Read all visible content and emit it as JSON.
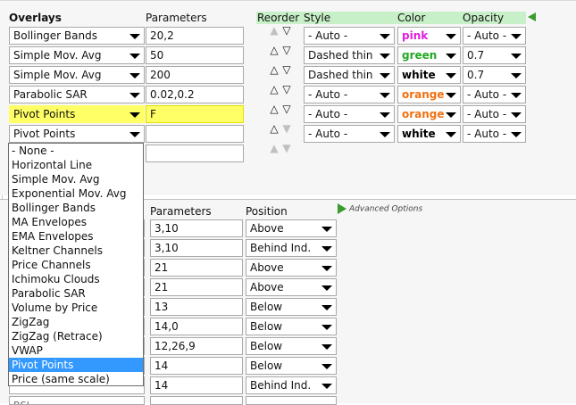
{
  "overlays_header": "Overlays",
  "parameters_header": "Parameters",
  "reorder_header": "Reorder",
  "style_header": "Style",
  "color_header": "Color",
  "opacity_header": "Opacity",
  "overlay_rows": [
    {
      "overlay": "Bollinger Bands",
      "params": "20,2",
      "style": "- Auto -",
      "color": "pink",
      "color_hex": "#e01ee0",
      "opacity": "- Auto -"
    },
    {
      "overlay": "Simple Mov. Avg",
      "params": "50",
      "style": "Dashed thin",
      "color": "green",
      "color_hex": "#22a822",
      "opacity": "0.7"
    },
    {
      "overlay": "Simple Mov. Avg",
      "params": "200",
      "style": "Dashed thin",
      "color": "white",
      "color_hex": "#000000",
      "opacity": "0.7"
    },
    {
      "overlay": "Parabolic SAR",
      "params": "0.02,0.2",
      "style": "- Auto -",
      "color": "orange",
      "color_hex": "#f07010",
      "opacity": "- Auto -"
    },
    {
      "overlay": "Pivot Points",
      "params": "F",
      "style": "- Auto -",
      "color": "orange",
      "color_hex": "#f07010",
      "opacity": "- Auto -"
    },
    {
      "overlay": "Pivot Points",
      "params": "",
      "style": "- Auto -",
      "color": "white",
      "color_hex": "#000000",
      "opacity": "- Auto -"
    }
  ],
  "dropdown_options": [
    "- None -",
    "Horizontal Line",
    "Simple Mov. Avg",
    "Exponential Mov. Avg",
    "Bollinger Bands",
    "MA Envelopes",
    "EMA Envelopes",
    "Keltner Channels",
    "Price Channels",
    "Ichimoku Clouds",
    "Parabolic SAR",
    "Volume by Price",
    "ZigZag",
    "ZigZag (Retrace)",
    "VWAP",
    "Pivot Points",
    "Price (same scale)"
  ],
  "dropdown_selected": "Pivot Points",
  "indicators_parameters_header": "Parameters",
  "indicators_position_header": "Position",
  "advanced_options": "Advanced Options",
  "indicator_rows": [
    {
      "params": "3,10",
      "position": "Above"
    },
    {
      "params": "3,10",
      "position": "Behind Ind."
    },
    {
      "params": "21",
      "position": "Above"
    },
    {
      "params": "21",
      "position": "Above"
    },
    {
      "params": "13",
      "position": "Below"
    },
    {
      "params": "14,0",
      "position": "Below"
    },
    {
      "params": "12,26,9",
      "position": "Below"
    },
    {
      "params": "14",
      "position": "Below"
    },
    {
      "params": "14",
      "position": "Behind Ind."
    }
  ],
  "partial_row_label": "RSI"
}
